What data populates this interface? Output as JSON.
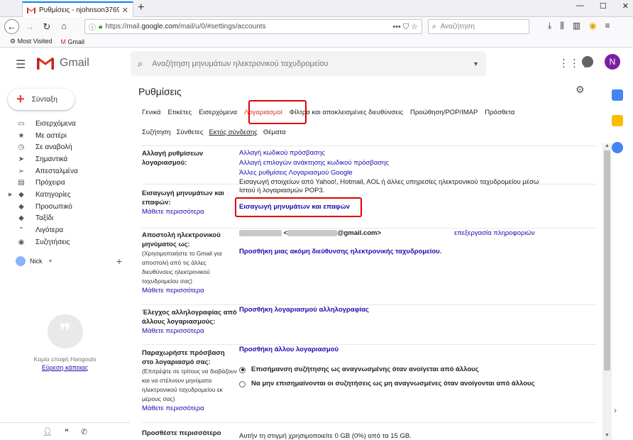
{
  "browser": {
    "tab_title": "Ρυθμίσεις - njohnson3769@gm",
    "tab_close": "✕",
    "new_tab": "+",
    "url_prefix": "https://mail.",
    "url_host": "google.com",
    "url_path": "/mail/u/0/#settings/accounts",
    "url_tools": "••• ⛉ ☆",
    "search_placeholder": "Αναζήτηση",
    "bookmarks": [
      "Most Visited",
      "Gmail"
    ],
    "win_controls": [
      "—",
      "☐",
      "✕"
    ]
  },
  "gmail": {
    "logo_text": "Gmail",
    "search_placeholder": "Αναζήτηση μηνυμάτων ηλεκτρονικού ταχυδρομείου",
    "avatar_letter": "N",
    "compose": "Σύνταξη",
    "nav": [
      {
        "label": "Εισερχόμενα",
        "icon": "▭"
      },
      {
        "label": "Με αστέρι",
        "icon": "★"
      },
      {
        "label": "Σε αναβολή",
        "icon": "◷"
      },
      {
        "label": "Σημαντικά",
        "icon": "➤"
      },
      {
        "label": "Απεσταλμένα",
        "icon": "➢"
      },
      {
        "label": "Πρόχειρα",
        "icon": "▤"
      },
      {
        "label": "Κατηγορίες",
        "icon": "◆"
      },
      {
        "label": "Προσωπικό",
        "icon": "◆"
      },
      {
        "label": "Ταξίδι",
        "icon": "◆"
      },
      {
        "label": "Λιγότερα",
        "icon": "⌃"
      },
      {
        "label": "Συζητήσεις",
        "icon": "◉"
      }
    ],
    "hangouts": {
      "user": "Nick",
      "empty_text": "Καμία επαφή Hangouts",
      "find_link": "Εύρεση κάποιας"
    }
  },
  "settings": {
    "title": "Ρυθμίσεις",
    "tabs_row1": [
      "Γενικά",
      "Ετικέτες",
      "Εισερχόμενα",
      "Λογαριασμοί",
      "Φίλτρα και αποκλεισμένες διευθύνσεις",
      "Προώθηση/POP/IMAP",
      "Πρόσθετα"
    ],
    "tabs_row2": [
      "Συζήτηση",
      "Σύνθετες",
      "Εκτός σύνδεσης",
      "Θέματα"
    ],
    "learn_more": "Μάθετε περισσότερα",
    "sections": {
      "change": {
        "label": "Αλλαγή ρυθμίσεων λογαριασμού:",
        "links": [
          "Αλλαγή κωδικού πρόσβασης",
          "Αλλαγή επιλογών ανάκτησης κωδικού πρόσβασης",
          "Άλλες ρυθμίσεις Λογαριασμού Google"
        ]
      },
      "import": {
        "label": "Εισαγωγή μηνυμάτων και επαφών:",
        "desc": "Εισαγωγή στοιχείων από Yahoo!, Hotmail, AOL ή άλλες υπηρεσίες ηλεκτρονικού ταχυδρομείου μέσω Ιστού ή λογαριασμών POP3.",
        "action": "Εισαγωγή μηνυμάτων και επαφών"
      },
      "send": {
        "label": "Αποστολή ηλεκτρονικού μηνύματος ως:",
        "sub": "(Χρησιμοποιήστε το Gmail για αποστολή από τις άλλες διευθύνσεις ηλεκτρονικού ταχυδρομείου σας)",
        "email_open": "<",
        "email_domain": "@gmail.com>",
        "edit": "επεξεργασία πληροφοριών",
        "add": "Προσθήκη μιας ακόμη διεύθυνσης ηλεκτρονικής ταχυδρομείου."
      },
      "check": {
        "label": "Έλεγχος αλληλογραφίας από άλλους λογαριασμούς:",
        "add": "Προσθήκη λογαριασμού αλληλογραφίας"
      },
      "grant": {
        "label": "Παραχωρήστε πρόσβαση στο λογαριασμό σας:",
        "sub": "(Επιτρέψτε σε τρίτους να διαβάζουν και να στέλνουν μηνύματα ηλεκτρονικού ταχυδρομείου εκ μέρους σας)",
        "add": "Προσθήκη άλλου λογαριασμού",
        "opt1": "Επισήμανση συζήτησης ως αναγνωσμένης όταν ανοίγεται από άλλους",
        "opt2": "Να μην επισημαίνονται οι συζητήσεις ως μη αναγνωσμένες όταν ανοίγονται από άλλους"
      },
      "storage": {
        "label": "Προσθέστε περισσότερο",
        "text": "Αυτήν τη στιγμή χρησιμοποιείτε 0 GB (0%) από τα 15 GB."
      }
    }
  }
}
